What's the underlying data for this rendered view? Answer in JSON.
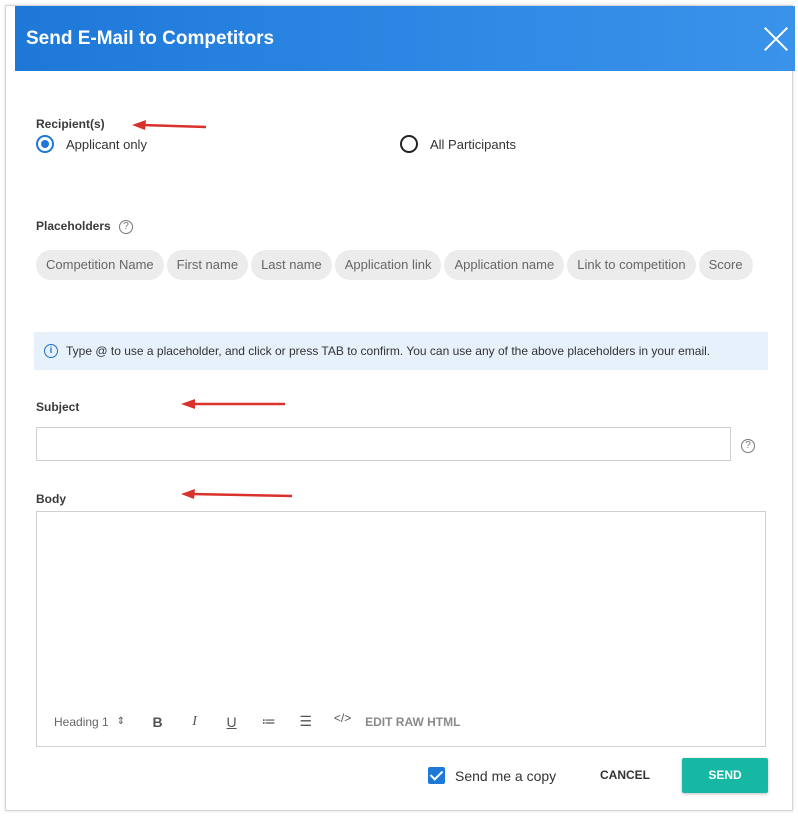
{
  "dialog": {
    "title": "Send E-Mail to Competitors"
  },
  "recipients": {
    "label": "Recipient(s)",
    "options": [
      {
        "label": "Applicant only",
        "selected": true
      },
      {
        "label": "All Participants",
        "selected": false
      }
    ]
  },
  "placeholders": {
    "label": "Placeholders",
    "help_icon": "?",
    "chips": [
      "Competition Name",
      "First name",
      "Last name",
      "Application link",
      "Application name",
      "Link to competition",
      "Score"
    ]
  },
  "info": {
    "icon": "i",
    "text": "Type @ to use a placeholder, and click or press TAB to confirm. You can use any of the above placeholders in your email."
  },
  "subject": {
    "label": "Subject",
    "value": "",
    "help_icon": "?"
  },
  "body": {
    "label": "Body",
    "value": "",
    "toolbar": {
      "heading": "Heading 1",
      "heading_arrows": "⇕",
      "bold": "B",
      "italic": "I",
      "underline": "U",
      "ordered_list": "≔",
      "bullet_list": "☰",
      "code": "</>",
      "raw_html": "EDIT RAW HTML"
    }
  },
  "footer": {
    "copy_label": "Send me a copy",
    "copy_checked": true,
    "cancel_label": "CANCEL",
    "send_label": "SEND"
  },
  "colors": {
    "header": "#1e78d8",
    "accent": "#1e78d8",
    "send": "#16b8a4",
    "annotation_arrow": "#d9312b"
  }
}
